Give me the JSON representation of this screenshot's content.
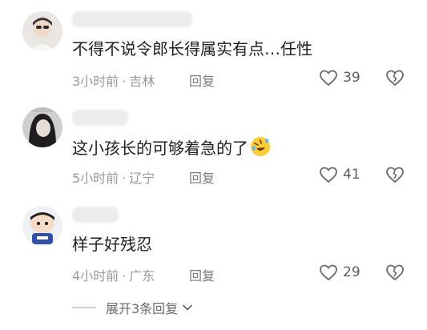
{
  "comments": [
    {
      "text": "不得不说令郎长得属实有点…任性",
      "time": "3小时前",
      "location": "吉林",
      "reply_label": "回复",
      "likes": "39"
    },
    {
      "text": "这小孩长的可够着急的了",
      "time": "5小时前",
      "location": "辽宁",
      "reply_label": "回复",
      "likes": "41",
      "emoji": "rolling-on-floor-laughing"
    },
    {
      "text": "样子好残忍",
      "time": "4小时前",
      "location": "广东",
      "reply_label": "回复",
      "likes": "29"
    }
  ],
  "expand": {
    "label": "展开3条回复"
  },
  "icons": {
    "heart": "heart-outline-icon",
    "broken_heart": "broken-heart-icon",
    "chevron": "chevron-down-icon"
  },
  "colors": {
    "text": "#1f1f1f",
    "meta": "#9a9a9a",
    "reply": "#7c7c7c",
    "icon": "#6a6a6a"
  }
}
